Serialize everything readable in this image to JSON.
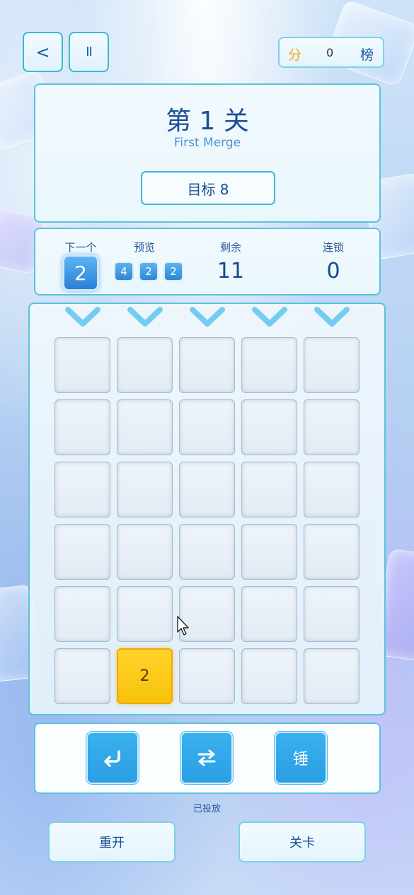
{
  "header": {
    "back_label": "<",
    "pause_label": "II",
    "score_label": "分",
    "score_value": "0",
    "rank_label": "榜",
    "score_color": "#f2a91a"
  },
  "level": {
    "title": "第 1 关",
    "subtitle": "First Merge",
    "goal": "目标 8"
  },
  "stats": {
    "next_label": "下一个",
    "next_value": "2",
    "preview_label": "预览",
    "preview_values": [
      "4",
      "2",
      "2"
    ],
    "remaining_label": "剩余",
    "remaining_value": "11",
    "chain_label": "连锁",
    "chain_value": "0"
  },
  "board": {
    "columns": 5,
    "rows": 6,
    "tiles": [
      {
        "row": 6,
        "col": 2,
        "value": "2",
        "color": "#f7c20c"
      }
    ]
  },
  "tools": {
    "undo_icon": "undo-arrow-icon",
    "swap_icon": "swap-arrows-icon",
    "hammer_label": "锤"
  },
  "status_text": "已投放",
  "bottom": {
    "restart_label": "重开",
    "levels_label": "关卡"
  }
}
